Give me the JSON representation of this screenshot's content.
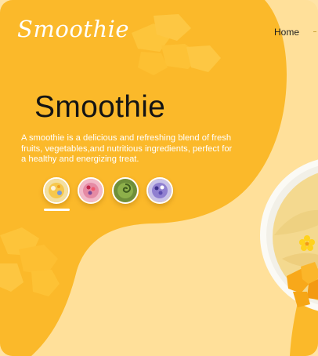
{
  "header": {
    "logo_text": "Smoothie",
    "nav": {
      "home_label": "Home"
    }
  },
  "hero": {
    "title": "Smoothie",
    "description": "A smoothie is a delicious and refreshing blend of fresh fruits, vegetables,and nutritious ingredients, perfect for a healthy and energizing treat."
  },
  "thumbnails": [
    {
      "name": "mango-smoothie-bowl",
      "selected": true
    },
    {
      "name": "berry-smoothie-bowl",
      "selected": false
    },
    {
      "name": "green-smoothie-bowl",
      "selected": false
    },
    {
      "name": "blueberry-smoothie-bowl",
      "selected": false
    }
  ],
  "colors": {
    "accent": "#fbb92a",
    "background_light": "#ffe09a",
    "text_dark": "#141414",
    "text_light": "#ffffff"
  }
}
